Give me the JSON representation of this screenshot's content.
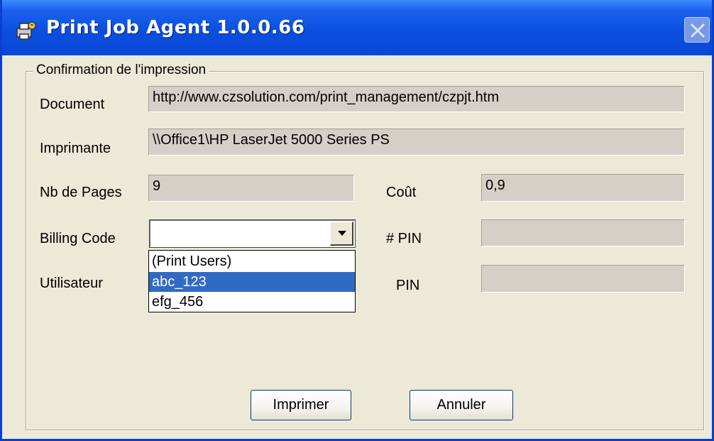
{
  "window": {
    "title": "Print Job Agent 1.0.0.66",
    "icon": "print-agent-icon",
    "close_icon": "close-icon"
  },
  "group": {
    "legend": "Confirmation de l'impression"
  },
  "fields": {
    "document_label": "Document",
    "document_value": "http://www.czsolution.com/print_management/czpjt.htm",
    "printer_label": "Imprimante",
    "printer_value": "\\\\Office1\\HP LaserJet 5000 Series PS",
    "pages_label": "Nb de Pages",
    "pages_value": "9",
    "cost_label": "Coût",
    "cost_value": "0,9",
    "billing_label": "Billing Code",
    "billing_value": "",
    "pin_number_label": "# PIN",
    "pin_number_value": "",
    "user_label": "Utilisateur",
    "pin_label": "PIN",
    "pin_value": ""
  },
  "dropdown": {
    "options": [
      "(Print Users)",
      "abc_123",
      "efg_456"
    ],
    "selected_index": 1
  },
  "buttons": {
    "print": "Imprimer",
    "cancel": "Annuler"
  },
  "colors": {
    "title_bar": "#0a4fe0",
    "selection": "#316ac5",
    "dialog_background": "#ece9d8",
    "readonly_field": "#d4d0c8"
  }
}
